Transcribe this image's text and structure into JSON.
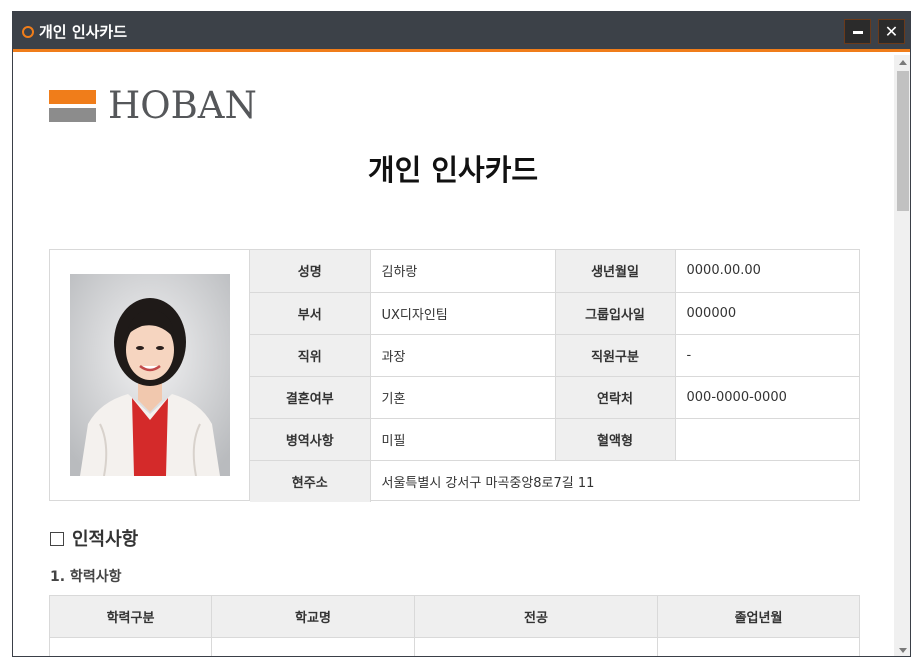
{
  "window": {
    "title": "개인 인사카드"
  },
  "logo": {
    "text": "HOBAN",
    "colors": {
      "top_bar": "#f07d1a",
      "bottom_bar": "#8c8c8c"
    }
  },
  "document": {
    "title": "개인 인사카드"
  },
  "profile": {
    "fields": [
      {
        "label": "성명",
        "value": "김하랑",
        "label2": "생년월일",
        "value2": "0000.00.00"
      },
      {
        "label": "부서",
        "value": "UX디자인팀",
        "label2": "그룹입사일",
        "value2": "000000"
      },
      {
        "label": "직위",
        "value": "과장",
        "label2": "직원구분",
        "value2": "-"
      },
      {
        "label": "결혼여부",
        "value": "기혼",
        "label2": "연락처",
        "value2": "000-0000-0000"
      },
      {
        "label": "병역사항",
        "value": "미필",
        "label2": "혈액형",
        "value2": ""
      }
    ],
    "address": {
      "label": "현주소",
      "value": "서울특별시 강서구 마곡중앙8로7길 11"
    }
  },
  "personal_section": {
    "title": "인적사항",
    "subsection": "1. 학력사항",
    "columns": [
      "학력구분",
      "학교명",
      "전공",
      "졸업년월"
    ],
    "rows": []
  },
  "colors": {
    "accent": "#f07d1a",
    "titlebar": "#3c4148",
    "label_bg": "#efefef",
    "border": "#d9d9d9"
  }
}
